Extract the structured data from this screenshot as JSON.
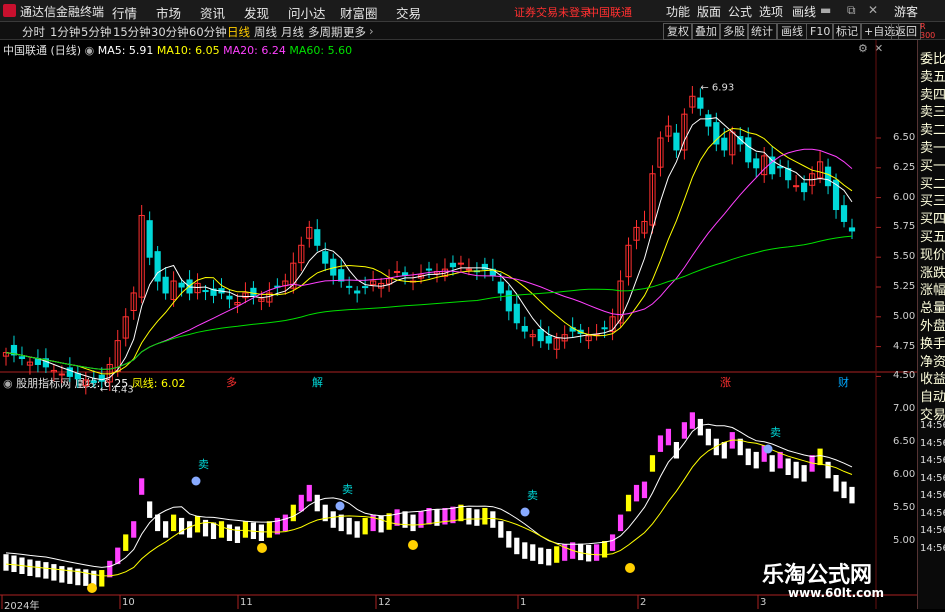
{
  "titlebar": {
    "app_name": "通达信金融终端",
    "menus": [
      "行情",
      "市场",
      "资讯",
      "发现",
      "问小达",
      "财富圈",
      "交易"
    ],
    "warning": "证券交易未登录",
    "stock": "中国联通",
    "right_menus": [
      "功能",
      "版面",
      "公式",
      "选项",
      "画线"
    ],
    "guest": "游客"
  },
  "toolbar": {
    "timeframes": [
      "分时",
      "1分钟",
      "5分钟",
      "15分钟",
      "30分钟",
      "60分钟",
      "日线",
      "周线",
      "月线",
      "多周期",
      "更多"
    ],
    "selected": "日线",
    "right_buttons": [
      "复权",
      "叠加",
      "多股",
      "统计",
      "画线",
      "F10",
      "标记",
      "+自选",
      "返回"
    ]
  },
  "main_legend": {
    "name": "中国联通 (日线)",
    "ma5": "MA5: 5.91",
    "ma10": "MA10: 6.05",
    "ma20": "MA20: 6.24",
    "ma60": "MA60: 5.60",
    "colors": {
      "ma5": "#ffffff",
      "ma10": "#ffff00",
      "ma20": "#ff40ff",
      "ma60": "#00e000"
    }
  },
  "sub_legend": {
    "name": "股朋指标网",
    "line1": "凰线: 6.25",
    "line2": "凤线: 6.02"
  },
  "right_panel": {
    "items": [
      "委比",
      "卖五",
      "卖四",
      "卖三",
      "卖二",
      "卖一",
      "买一",
      "买二",
      "买三",
      "买四",
      "买五",
      "现价",
      "涨跌",
      "涨幅",
      "总量",
      "外盘",
      "换手",
      "净资",
      "收益",
      "自动",
      "交易"
    ],
    "side_times": [
      "14:56",
      "14:56",
      "14:56",
      "14:56",
      "14:56",
      "14:56",
      "14:56",
      "14:56"
    ]
  },
  "chart_data": {
    "type": "candlestick",
    "main_yaxis": [
      "6.50",
      "6.25",
      "6.00",
      "5.75",
      "5.50",
      "5.25",
      "5.00",
      "4.75",
      "4.50"
    ],
    "sub_yaxis": [
      "7.00",
      "6.50",
      "6.00",
      "5.50",
      "5.00"
    ],
    "annotations": {
      "high": "6.93",
      "low": "4.43"
    },
    "event_marks": [
      "多",
      "解",
      "涨",
      "财"
    ],
    "sell_marks": [
      "卖",
      "卖",
      "卖",
      "卖"
    ],
    "dates": [
      "2024年",
      "10",
      "11",
      "12",
      "1",
      "2",
      "3"
    ]
  },
  "watermark": {
    "title": "乐淘公式网",
    "url": "www.60lt.com"
  },
  "corner_badge": {
    "r": "R",
    "num": "300"
  }
}
